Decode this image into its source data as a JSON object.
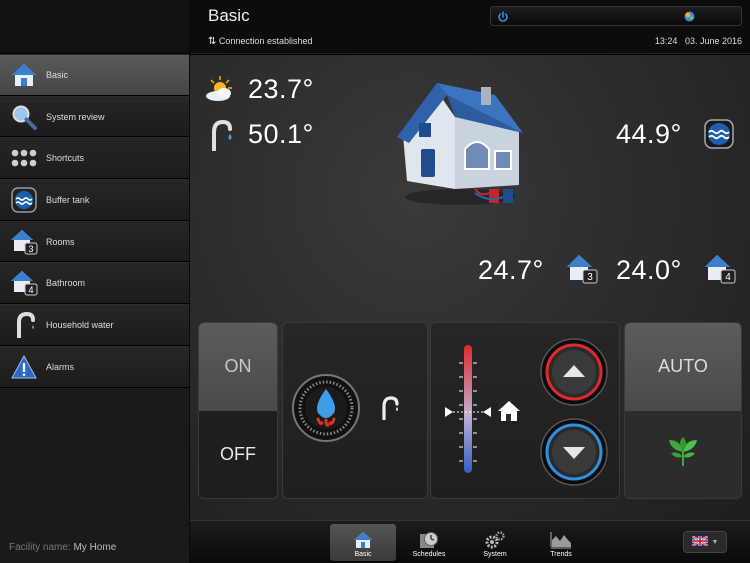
{
  "header": {
    "title": "Basic",
    "connection": "Connection established",
    "time": "13:24",
    "date": "03. June 2016"
  },
  "sidebar": {
    "items": [
      {
        "label": "Basic",
        "icon": "house-icon"
      },
      {
        "label": "System review",
        "icon": "magnifier-icon"
      },
      {
        "label": "Shortcuts",
        "icon": "grid-dots-icon"
      },
      {
        "label": "Buffer tank",
        "icon": "buffer-tank-icon"
      },
      {
        "label": "Rooms",
        "icon": "house-3-icon"
      },
      {
        "label": "Bathroom",
        "icon": "house-4-icon"
      },
      {
        "label": "Household water",
        "icon": "faucet-icon"
      },
      {
        "label": "Alarms",
        "icon": "warning-icon"
      }
    ],
    "facility_label": "Facility name:",
    "facility_name": "My Home"
  },
  "main": {
    "outdoor_temp": "23.7°",
    "hot_water_temp": "50.1°",
    "buffer_temp": "44.9°",
    "room3_temp": "24.7°",
    "room4_temp": "24.0°",
    "room3_badge": "3",
    "room4_badge": "4"
  },
  "controls": {
    "on_label": "ON",
    "off_label": "OFF",
    "auto_label": "AUTO"
  },
  "bottombar": {
    "tabs": [
      {
        "label": "Basic"
      },
      {
        "label": "Schedules"
      },
      {
        "label": "System"
      },
      {
        "label": "Trends"
      }
    ]
  },
  "colors": {
    "accent_blue": "#2f8fe0",
    "accent_red": "#e02a2a",
    "eco_green": "#3fa83f"
  }
}
